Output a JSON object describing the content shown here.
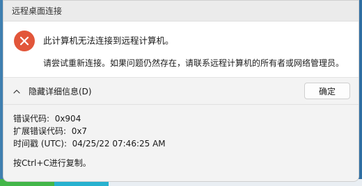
{
  "window": {
    "title": "远程桌面连接"
  },
  "message": {
    "main": "此计算机无法连接到远程计算机。",
    "sub": "请尝试重新连接。如果问题仍然存在，请联系远程计算机的所有者或网络管理员。"
  },
  "toggle": {
    "label": "隐藏详细信息(D)",
    "icon": "chevron-up-icon"
  },
  "ok_button": {
    "label": "确定"
  },
  "details": {
    "error_code_label": "错误代码:",
    "error_code_value": "0x904",
    "ext_error_code_label": "扩展错误代码:",
    "ext_error_code_value": "0x7",
    "timestamp_label": "时间戳 (UTC):",
    "timestamp_value": "04/25/22 07:46:25 AM",
    "copy_hint": "按Ctrl+C进行复制。"
  },
  "colors": {
    "error_red": "#e2563a",
    "dialog_bg": "#f3f3f3"
  }
}
